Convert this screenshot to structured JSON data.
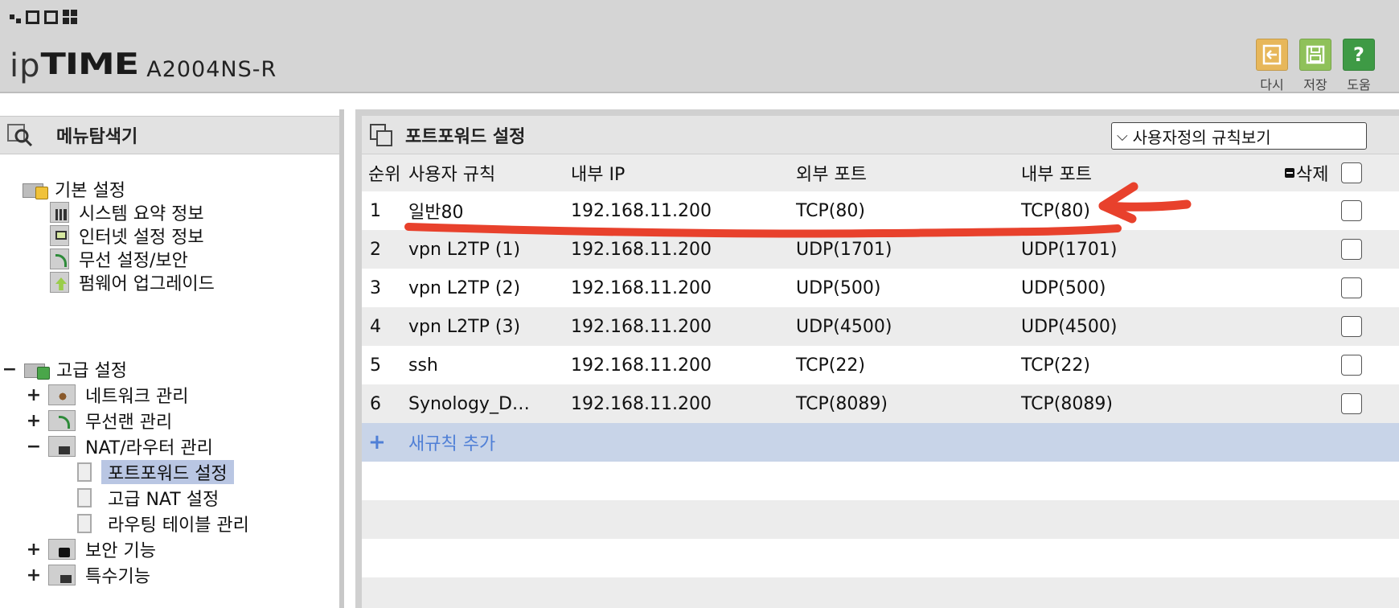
{
  "header": {
    "brand_ip": "ip",
    "brand_time": "TIME",
    "model": "A2004NS-R",
    "actions": [
      {
        "label": "다시",
        "icon": "undo-icon",
        "color": "#e7b75a"
      },
      {
        "label": "저장",
        "icon": "save-icon",
        "color": "#8fc15a"
      },
      {
        "label": "도움",
        "icon": "help-icon",
        "color": "#3e9a45"
      }
    ]
  },
  "sidebar": {
    "title": "메뉴탐색기",
    "basic": {
      "label": "기본 설정",
      "items": [
        "시스템 요약 정보",
        "인터넷 설정 정보",
        "무선 설정/보안",
        "펌웨어 업그레이드"
      ]
    },
    "advanced": {
      "expander": "−",
      "label": "고급 설정",
      "items": [
        {
          "expander": "+",
          "label": "네트워크 관리"
        },
        {
          "expander": "+",
          "label": "무선랜 관리"
        },
        {
          "expander": "−",
          "label": "NAT/라우터 관리"
        },
        {
          "expander": "+",
          "label": "보안 기능"
        },
        {
          "expander": "+",
          "label": "특수기능"
        }
      ],
      "nat_children": [
        "포트포워드 설정",
        "고급 NAT 설정",
        "라우팅 테이블 관리"
      ],
      "selected": "포트포워드 설정"
    }
  },
  "main": {
    "title": "포트포워드 설정",
    "filter_select": "사용자정의 규칙보기",
    "columns": {
      "index": "순위",
      "rule": "사용자 규칙",
      "internal_ip": "내부 IP",
      "external_port": "외부 포트",
      "internal_port": "내부 포트",
      "delete": "삭제"
    },
    "rows": [
      {
        "index": "1",
        "rule": "일반80",
        "internal_ip": "192.168.11.200",
        "external_port": "TCP(80)",
        "internal_port": "TCP(80)"
      },
      {
        "index": "2",
        "rule": "vpn L2TP (1)",
        "internal_ip": "192.168.11.200",
        "external_port": "UDP(1701)",
        "internal_port": "UDP(1701)"
      },
      {
        "index": "3",
        "rule": "vpn L2TP (2)",
        "internal_ip": "192.168.11.200",
        "external_port": "UDP(500)",
        "internal_port": "UDP(500)"
      },
      {
        "index": "4",
        "rule": "vpn L2TP (3)",
        "internal_ip": "192.168.11.200",
        "external_port": "UDP(4500)",
        "internal_port": "UDP(4500)"
      },
      {
        "index": "5",
        "rule": "ssh",
        "internal_ip": "192.168.11.200",
        "external_port": "TCP(22)",
        "internal_port": "TCP(22)"
      },
      {
        "index": "6",
        "rule": "Synology_D…",
        "internal_ip": "192.168.11.200",
        "external_port": "TCP(8089)",
        "internal_port": "TCP(8089)"
      }
    ],
    "add_rule": {
      "plus": "+",
      "label": "새규칙 추가"
    }
  },
  "annotation": {
    "color": "#e8412c"
  }
}
